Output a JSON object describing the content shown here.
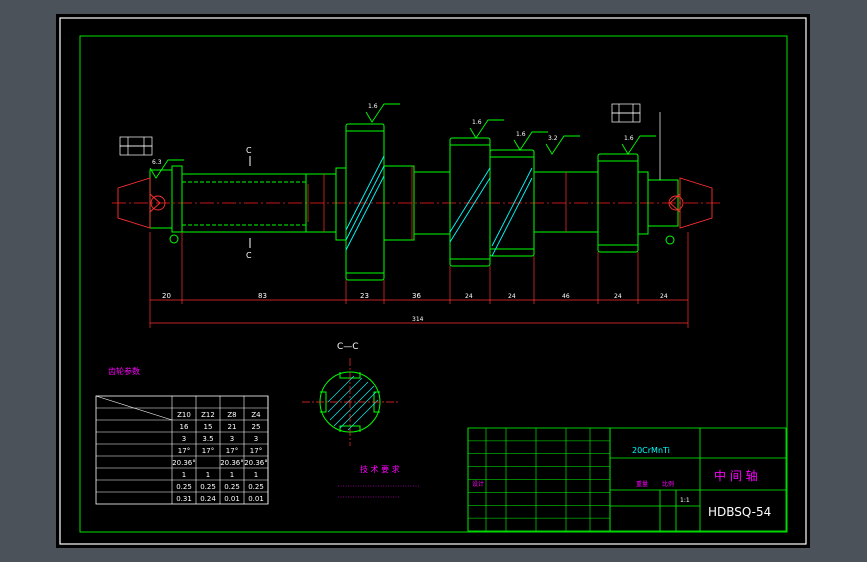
{
  "colors": {
    "background_outer": "#4b525a",
    "sheet": "#000000",
    "frame": "#ffffff",
    "border": "#00e000",
    "outline": "#00ff00",
    "center_line": "#ff2020",
    "dimension": "#ff3030",
    "text_white": "#ffffff",
    "text_magenta": "#ff00ff",
    "text_yellow": "#ffff00",
    "text_cyan": "#00ffff",
    "hatch": "#00ffff"
  },
  "section": {
    "cut_label": "C",
    "title": "C—C"
  },
  "roughness": [
    "1.6",
    "1.6",
    "1.6",
    "3.2",
    "1.6",
    "6.3"
  ],
  "dims": {
    "bottom": [
      "20",
      "83",
      "23",
      "36",
      "24",
      "24",
      "46",
      "24",
      "24"
    ],
    "overall": "314"
  },
  "gear_table": {
    "title": "齿轮参数",
    "columns": [
      "Z10",
      "Z12",
      "Z8",
      "Z4"
    ],
    "rows": [
      [
        "16",
        "15",
        "21",
        "25"
      ],
      [
        "3",
        "3.5",
        "3",
        "3"
      ],
      [
        "17°",
        "17°",
        "17°",
        "17°"
      ],
      [
        "20.36°",
        "",
        "20.36°",
        "20.36°"
      ],
      [
        "1",
        "1",
        "1",
        "1"
      ],
      [
        "0.25",
        "0.25",
        "0.25",
        "0.25"
      ],
      [
        "0.31",
        "0.24",
        "0.01",
        "0.01"
      ]
    ]
  },
  "tech_req": {
    "title": "技 术 要 求"
  },
  "title_block": {
    "material": "20CrMnTi",
    "part_name": "中 间 轴",
    "drawing_no": "HDBSQ-54",
    "scale": "1:1",
    "designer_label": "设计",
    "scale_label": "比例",
    "weight_label": "重量"
  }
}
